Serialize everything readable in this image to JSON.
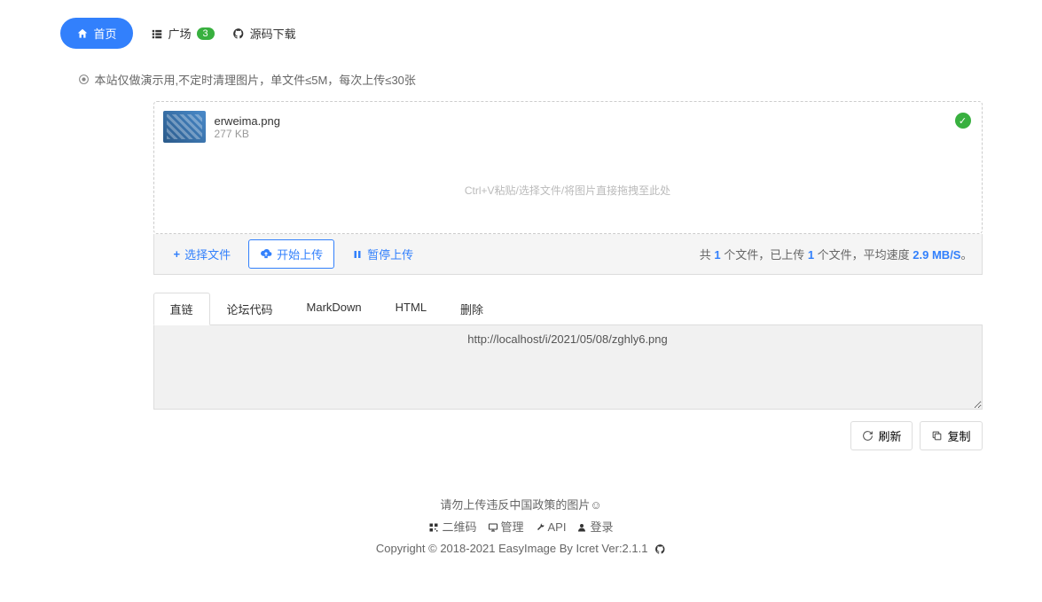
{
  "nav": {
    "home": "首页",
    "square": "广场",
    "square_badge": "3",
    "source": "源码下载"
  },
  "notice": "本站仅做演示用,不定时清理图片，单文件≤5M，每次上传≤30张",
  "upload": {
    "file_name": "erweima.png",
    "file_size": "277 KB",
    "drop_hint": "Ctrl+V粘贴/选择文件/将图片直接拖拽至此处"
  },
  "toolbar": {
    "select": "选择文件",
    "start": "开始上传",
    "pause": "暂停上传",
    "status_prefix": "共 ",
    "total_files": "1",
    "status_mid1": " 个文件，已上传 ",
    "uploaded_files": "1",
    "status_mid2": " 个文件，平均速度 ",
    "speed": "2.9 MB/S",
    "status_suffix": "。"
  },
  "tabs": {
    "direct": "直链",
    "bbcode": "论坛代码",
    "markdown": "MarkDown",
    "html": "HTML",
    "delete": "删除"
  },
  "result_url": "http://localhost/i/2021/05/08/zghly6.png",
  "actions": {
    "refresh": "刷新",
    "copy": "复制"
  },
  "footer": {
    "warning": "请勿上传违反中国政策的图片☺",
    "qrcode": "二维码",
    "admin": "管理",
    "api": "API",
    "login": "登录",
    "copyright": "Copyright © 2018-2021 EasyImage By Icret Ver:2.1.1"
  }
}
